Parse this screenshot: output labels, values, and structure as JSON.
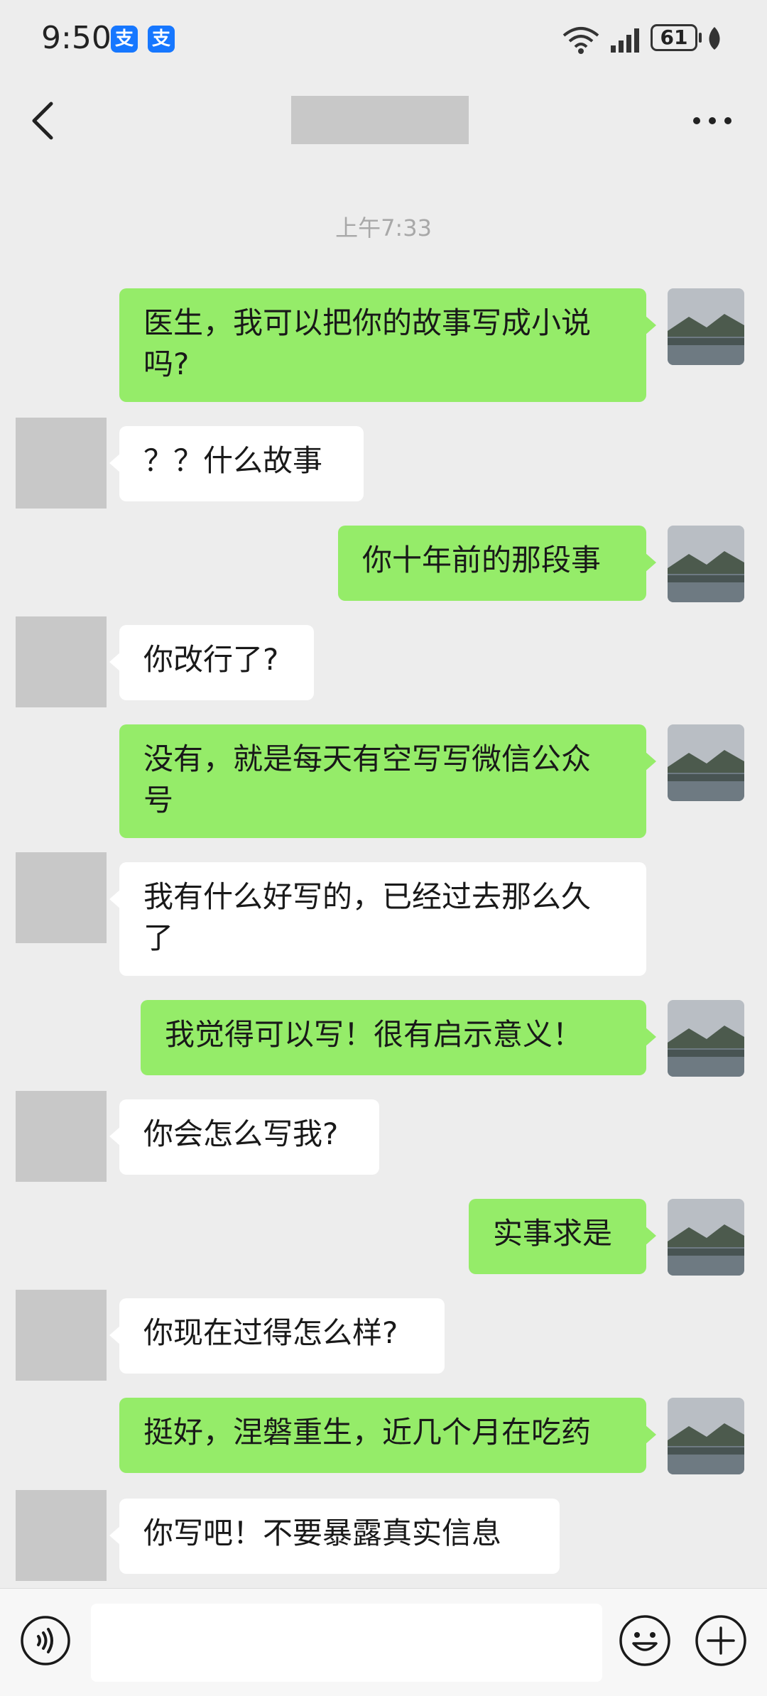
{
  "status_bar": {
    "time": "9:50",
    "pay_badges": [
      "支",
      "支"
    ],
    "battery": "61",
    "icons": [
      "wifi-icon",
      "signal-icon",
      "battery-icon",
      "leaf-icon"
    ]
  },
  "nav": {
    "back_icon": "chevron-left-icon",
    "more_icon": "more-dots-icon"
  },
  "chat": {
    "timestamp": "上午7:33",
    "messages": [
      {
        "from": "me",
        "lines": [
          "医生，我可以把你的故事写成小说",
          "吗?"
        ]
      },
      {
        "from": "them",
        "lines": [
          "？？什么故事"
        ]
      },
      {
        "from": "me",
        "lines": [
          "你十年前的那段事"
        ]
      },
      {
        "from": "them",
        "lines": [
          "你改行了?"
        ]
      },
      {
        "from": "me",
        "lines": [
          "没有，就是每天有空写写微信公众",
          "号"
        ]
      },
      {
        "from": "them",
        "lines": [
          "我有什么好写的，已经过去那么久",
          "了"
        ]
      },
      {
        "from": "me",
        "lines": [
          "我觉得可以写！很有启示意义！"
        ]
      },
      {
        "from": "them",
        "lines": [
          "你会怎么写我?"
        ]
      },
      {
        "from": "me",
        "lines": [
          "实事求是"
        ]
      },
      {
        "from": "them",
        "lines": [
          "你现在过得怎么样?"
        ]
      },
      {
        "from": "me",
        "lines": [
          "挺好，涅磐重生，近几个月在吃药"
        ]
      },
      {
        "from": "them",
        "lines": [
          "你写吧！不要暴露真实信息"
        ]
      }
    ]
  },
  "input_bar": {
    "voice_icon": "voice-icon",
    "text_value": "",
    "emoji_icon": "emoji-icon",
    "plus_icon": "plus-circle-icon"
  },
  "colors": {
    "background": "#ededed",
    "my_bubble": "#95ec69",
    "their_bubble": "#ffffff",
    "avatar_placeholder": "#c8c8c8",
    "alipay_blue": "#1677ff"
  }
}
